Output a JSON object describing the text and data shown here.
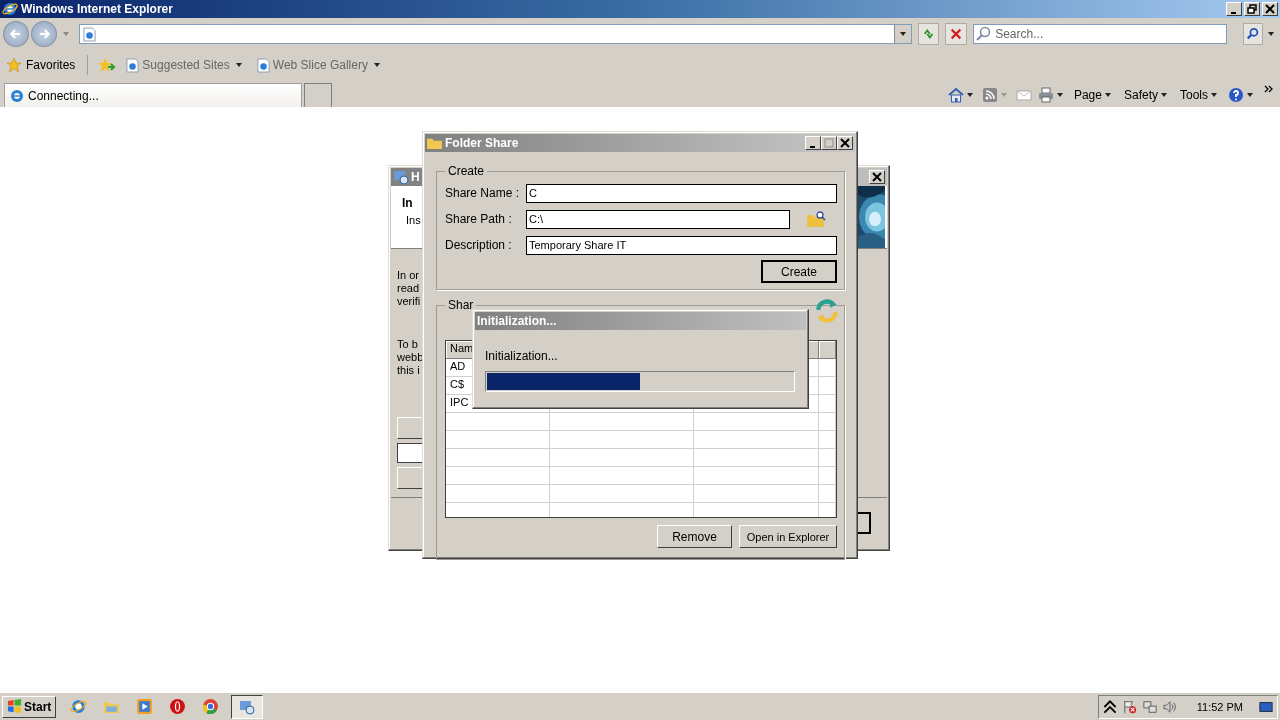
{
  "browser": {
    "title": "Windows Internet Explorer",
    "search": {
      "placeholder": "Search..."
    },
    "favorites": {
      "label": "Favorites",
      "links": [
        "Suggested Sites",
        "Web Slice Gallery"
      ]
    },
    "tabs": [
      {
        "label": "Connecting...",
        "selected": true
      }
    ],
    "commands": [
      "Page",
      "Safety",
      "Tools"
    ]
  },
  "background_window": {
    "title": "H",
    "heading": "In",
    "subheading": "Ins",
    "paragraphs": [
      [
        "In or",
        "read",
        "verifi"
      ],
      [
        "To b",
        "webb",
        "this i"
      ]
    ]
  },
  "folder_share": {
    "title": "Folder Share",
    "create_group": {
      "title": "Create",
      "fields": [
        {
          "label": "Share Name :",
          "value": "C",
          "browse": false
        },
        {
          "label": "Share Path :",
          "value": "C:\\",
          "browse": true
        },
        {
          "label": "Description :",
          "value": "Temporary Share IT",
          "browse": false
        }
      ],
      "button": "Create"
    },
    "shared_group": {
      "title": "Shar",
      "columns": [
        "Nam"
      ],
      "rows": [
        "AD",
        "C$",
        "IPC"
      ],
      "buttons": [
        "Remove",
        "Open in Explorer"
      ]
    }
  },
  "progress_dialog": {
    "title": "Initialization...",
    "message": "Initialization...",
    "level": 0.5
  },
  "taskbar": {
    "start": "Start",
    "clock": "11:52 PM"
  }
}
